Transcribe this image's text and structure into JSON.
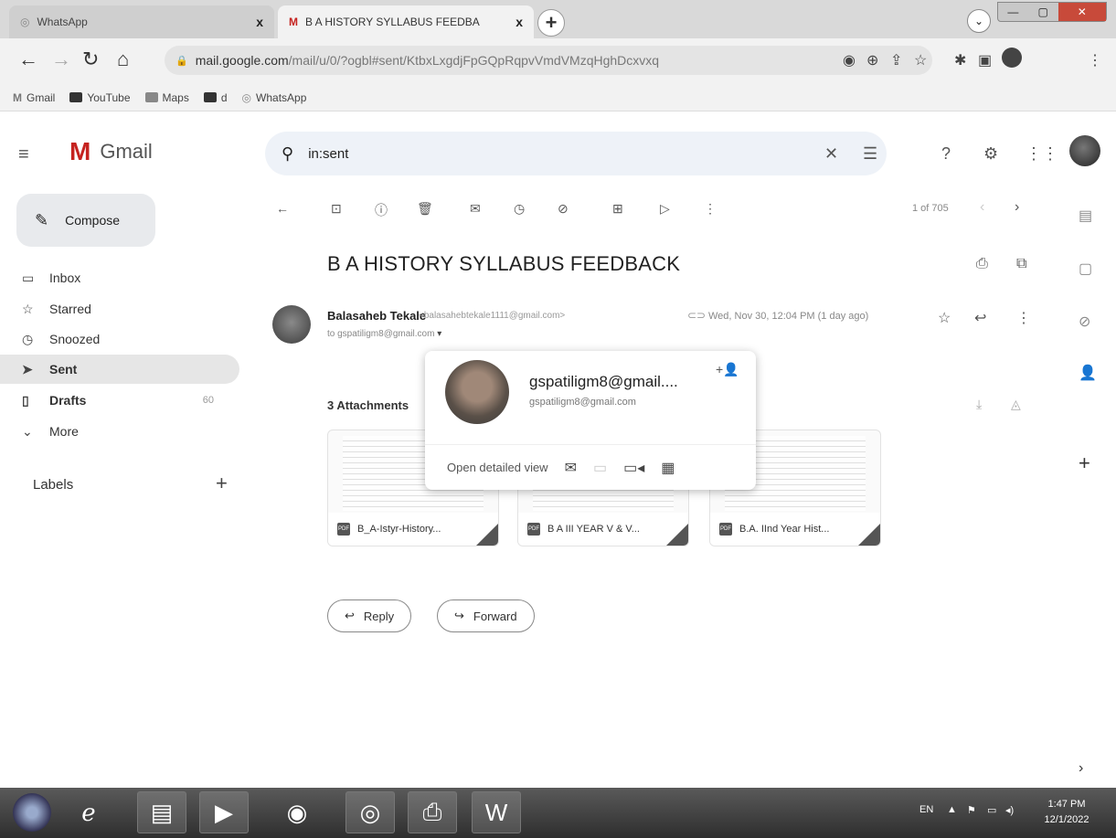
{
  "browser": {
    "tabs": [
      {
        "label": "WhatsApp",
        "icon": "whatsapp-icon",
        "close": "x"
      },
      {
        "label": "B A HISTORY SYLLABUS FEEDBA",
        "icon": "gmail-icon",
        "close": "x"
      }
    ],
    "new_tab": "+",
    "url_host": "mail.google.com",
    "url_path": "/mail/u/0/?ogbl#sent/KtbxLxgdjFpGQpRqpvVmdVMzqHghDcxvxq",
    "bookmarks": [
      {
        "label": "Gmail",
        "icon": "gmail-icon"
      },
      {
        "label": "YouTube",
        "icon": "youtube-icon"
      },
      {
        "label": "Maps",
        "icon": "maps-icon"
      },
      {
        "label": "d",
        "icon": "youtube-icon"
      },
      {
        "label": "WhatsApp",
        "icon": "whatsapp-icon"
      }
    ]
  },
  "gmail": {
    "logo_text": "Gmail",
    "search_value": "in:sent",
    "compose_label": "Compose",
    "nav": [
      {
        "label": "Inbox",
        "icon": "inbox-icon"
      },
      {
        "label": "Starred",
        "icon": "star-icon"
      },
      {
        "label": "Snoozed",
        "icon": "clock-icon"
      },
      {
        "label": "Sent",
        "icon": "send-icon",
        "active": true
      },
      {
        "label": "Drafts",
        "icon": "draft-icon",
        "count": "60"
      },
      {
        "label": "More",
        "icon": "chevron-down-icon"
      }
    ],
    "labels_heading": "Labels",
    "pager": "1 of 705"
  },
  "message": {
    "subject": "B A HISTORY SYLLABUS FEEDBACK",
    "sender_name": "Balasaheb Tekale",
    "sender_email": "<balasahebtekale1111@gmail.com>",
    "to_line": "to gspatiligm8@gmail.com",
    "date": "Wed, Nov 30, 12:04 PM (1 day ago)",
    "attachments_heading": "3 Attachments",
    "attachments": [
      {
        "name": "B_A-Istyr-History..."
      },
      {
        "name": "B A III YEAR V & V..."
      },
      {
        "name": "B.A. IInd Year Hist..."
      }
    ],
    "reply_label": "Reply",
    "forward_label": "Forward"
  },
  "hovercard": {
    "name": "gspatiligm8@gmail....",
    "email": "gspatiligm8@gmail.com",
    "open_detailed_view": "Open detailed view"
  },
  "taskbar": {
    "lang": "EN",
    "time": "1:47 PM",
    "date": "12/1/2022"
  },
  "colors": {
    "search_bg": "#eef2f8",
    "sent_active_bg": "#e6e6e6",
    "gmail_red": "#c5221f"
  }
}
